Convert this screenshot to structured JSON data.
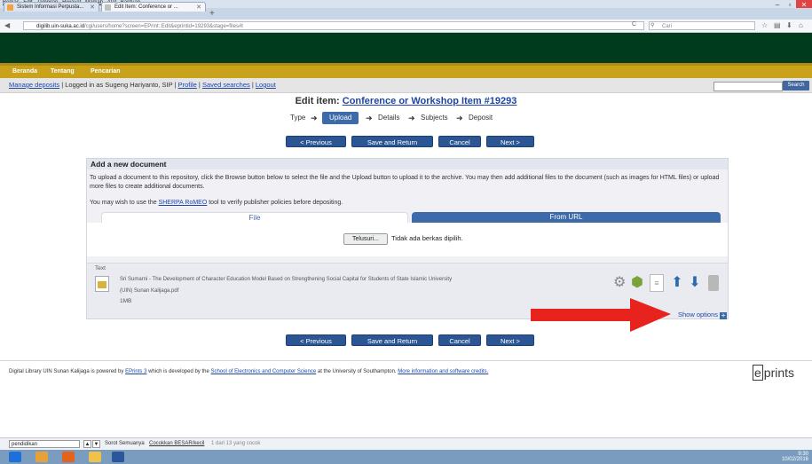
{
  "browser": {
    "menu": [
      "Berkas",
      "Edit",
      "Tampilan",
      "Riwayat",
      "Markah",
      "Alat",
      "Bantuan"
    ],
    "tabs": [
      {
        "label": "Sistem Informasi Perpusta..."
      },
      {
        "label": "Edit Item: Conference or ..."
      }
    ],
    "new_tab": "+",
    "url_host": "digilib.uin-suka.ac.id",
    "url_path": "/cgi/users/home?screen=EPrint::Edit&eprintid=19293&stage=files#t",
    "search_placeholder": "Cari"
  },
  "site": {
    "nav": [
      "Beranda",
      "Tentang",
      "Pencarian"
    ],
    "account": {
      "manage": "Manage deposits",
      "logged_in": "Logged in as Sugeng Hariyanto, SIP",
      "profile": "Profile",
      "saved": "Saved searches",
      "logout": "Logout"
    },
    "search_button": "Search"
  },
  "edit": {
    "title_prefix": "Edit item: ",
    "title_link": "Conference or Workshop Item #19293",
    "steps": [
      "Type",
      "Upload",
      "Details",
      "Subjects",
      "Deposit"
    ],
    "active_step": "Upload",
    "buttons": {
      "previous": "< Previous",
      "save_return": "Save and Return",
      "cancel": "Cancel",
      "next": "Next >"
    }
  },
  "panel": {
    "heading": "Add a new document",
    "intro": "To upload a document to this repository, click the Browse button below to select the file and the Upload button to upload it to the archive. You may then add additional files to the document (such as images for HTML files) or upload more files to create additional documents.",
    "sherpa_pre": "You may wish to use the ",
    "sherpa_link": "SHERPA RoMEO",
    "sherpa_post": " tool to verify publisher policies before depositing.",
    "tab_file": "File",
    "tab_url": "From URL",
    "browse": "Telusuri...",
    "no_file": "Tidak ada berkas dipilih.",
    "document": {
      "type": "Text",
      "title": "Sri Sumarni - The Development of Character Education Model Based on Strengthening Social Capital for Students of State Islamic University",
      "filename": "(UIN) Sunan Kalijaga.pdf",
      "size": "1MB"
    },
    "show_options": "Show options"
  },
  "footer": {
    "pre": "Digital Library UIN Sunan Kalijaga is powered by ",
    "eprints_link": "EPrints 3",
    "mid": " which is developed by the ",
    "school_link": "School of Electronics and Computer Science",
    "post": " at the University of Southampton. ",
    "more_link": "More information and software credits.",
    "logo_e": "e",
    "logo_rest": "prints"
  },
  "findbar": {
    "value": "pendidikan",
    "highlight": "Sorot Semuanya",
    "match_case": "Cocokkan BESAR/kecil",
    "result": "1 dari 13 yang cocok"
  },
  "tray": {
    "time": "9:30",
    "date": "10/02/2016"
  },
  "colors": {
    "header_green": "#003b1e",
    "nav_gold": "#c9a21b",
    "button_blue": "#2c5594",
    "link_blue": "#1e46a8",
    "arrow_red": "#e8231d"
  }
}
